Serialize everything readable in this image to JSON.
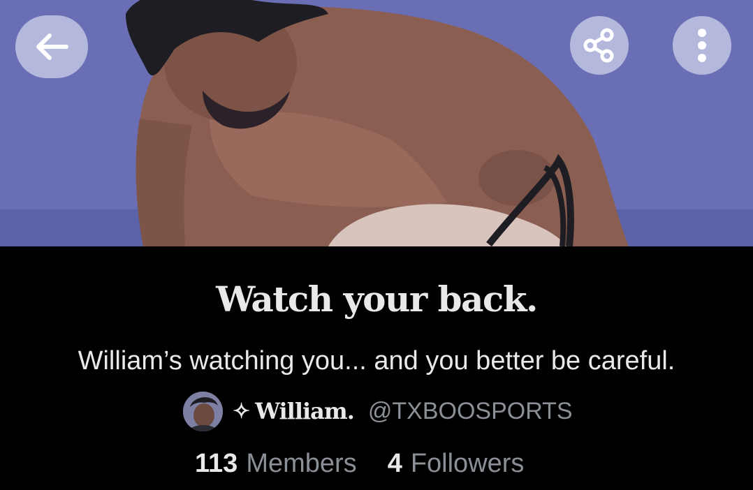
{
  "header": {
    "back_icon": "arrow-left-icon",
    "share_icon": "share-icon",
    "more_icon": "more-vertical-icon"
  },
  "community": {
    "title": "Watch your back.",
    "description": "William’s watching you... and you better be careful.",
    "owner": {
      "badge_icon": "sparkle-icon",
      "badge_glyph": "✧",
      "name": "William.",
      "handle": "@TXBOOSPORTS"
    },
    "stats": {
      "members_count": "113",
      "members_label": "Members",
      "followers_count": "4",
      "followers_label": "Followers"
    }
  },
  "colors": {
    "background": "#000000",
    "text_primary": "#e7e9ea",
    "text_secondary": "#8b9096",
    "banner_bg": "#6b70b6",
    "header_button_bg": "#c4c8e4"
  }
}
